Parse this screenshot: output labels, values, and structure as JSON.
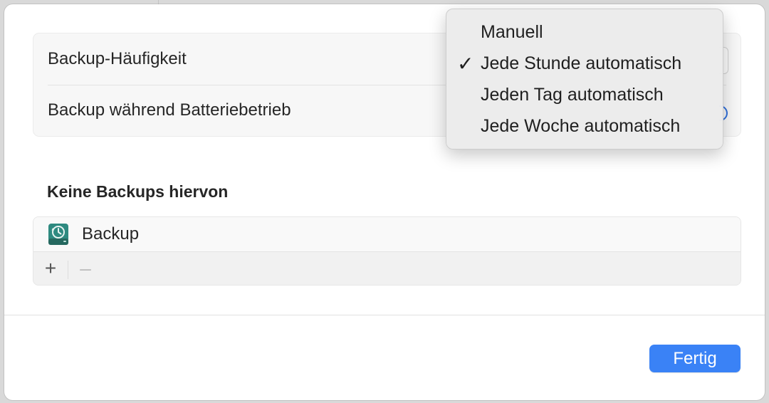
{
  "settings": {
    "frequency_label": "Backup-Häufigkeit",
    "battery_label": "Backup während Batteriebetrieb"
  },
  "excluded": {
    "title": "Keine Backups hiervon",
    "items": [
      {
        "label": "Backup",
        "icon": "time-machine-disk-icon"
      }
    ],
    "add_label": "+",
    "remove_label": "–"
  },
  "footer": {
    "done_label": "Fertig"
  },
  "frequency_menu": {
    "selected_index": 1,
    "options": [
      {
        "label": "Manuell"
      },
      {
        "label": "Jede Stunde automatisch",
        "checked": true
      },
      {
        "label": "Jeden Tag automatisch"
      },
      {
        "label": "Jede Woche automatisch"
      }
    ],
    "check_mark": "✓"
  },
  "colors": {
    "accent": "#3a82f6",
    "icon_teal": "#2e8a80"
  }
}
